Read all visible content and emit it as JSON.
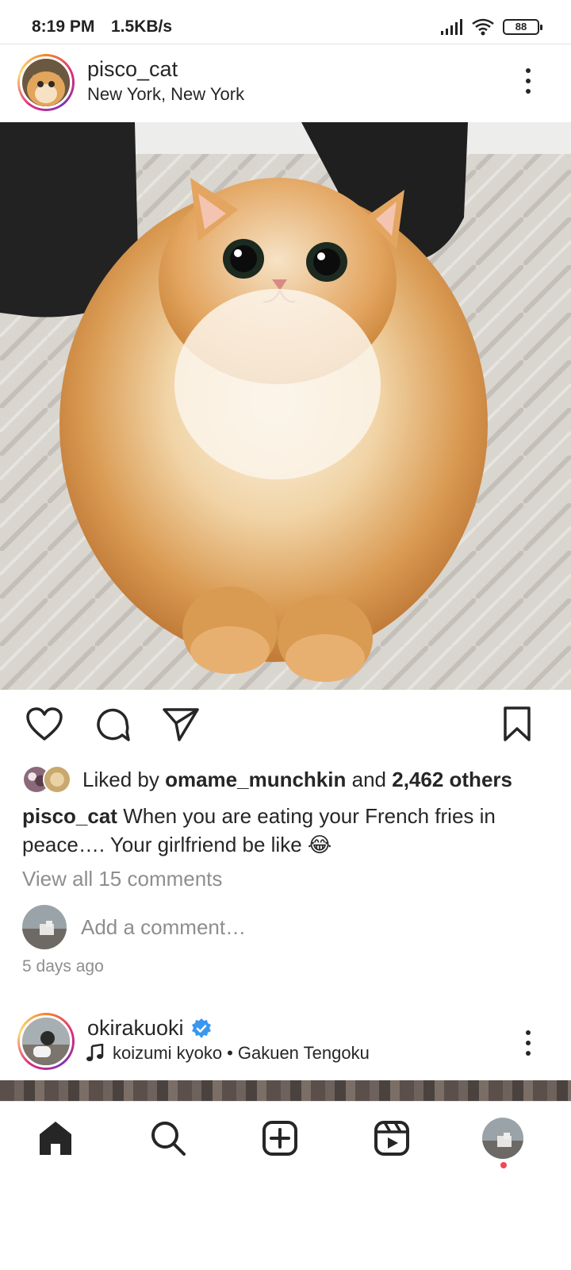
{
  "status_bar": {
    "time": "8:19 PM",
    "speed": "1.5KB/s",
    "battery": "88"
  },
  "post1": {
    "username": "pisco_cat",
    "location": "New York, New York",
    "liked_by_prefix": "Liked by",
    "liked_by_user": "omame_munchkin",
    "liked_by_and": "and",
    "likes_count": "2,462 others",
    "caption_user": "pisco_cat",
    "caption_text": "When you are eating your French fries in peace…. Your girlfriend be like 😂",
    "view_all_comments": "View all 15 comments",
    "add_comment_placeholder": "Add a comment…",
    "time_ago": "5 days ago"
  },
  "post2": {
    "username": "okirakuoki",
    "verified": true,
    "music_artist": "koizumi kyoko",
    "music_separator": "•",
    "music_title": "Gakuen Tengoku"
  },
  "bottom_nav": {
    "items": [
      "home-icon",
      "search-icon",
      "create-icon",
      "reels-icon",
      "profile-avatar"
    ],
    "notification_dot_color": "#ed4956"
  },
  "colors": {
    "text_primary": "#262626",
    "text_secondary": "#8e8e8e",
    "verified_blue": "#3897f0",
    "story_ring": [
      "#f58529",
      "#dd2a7b",
      "#8134af"
    ]
  }
}
